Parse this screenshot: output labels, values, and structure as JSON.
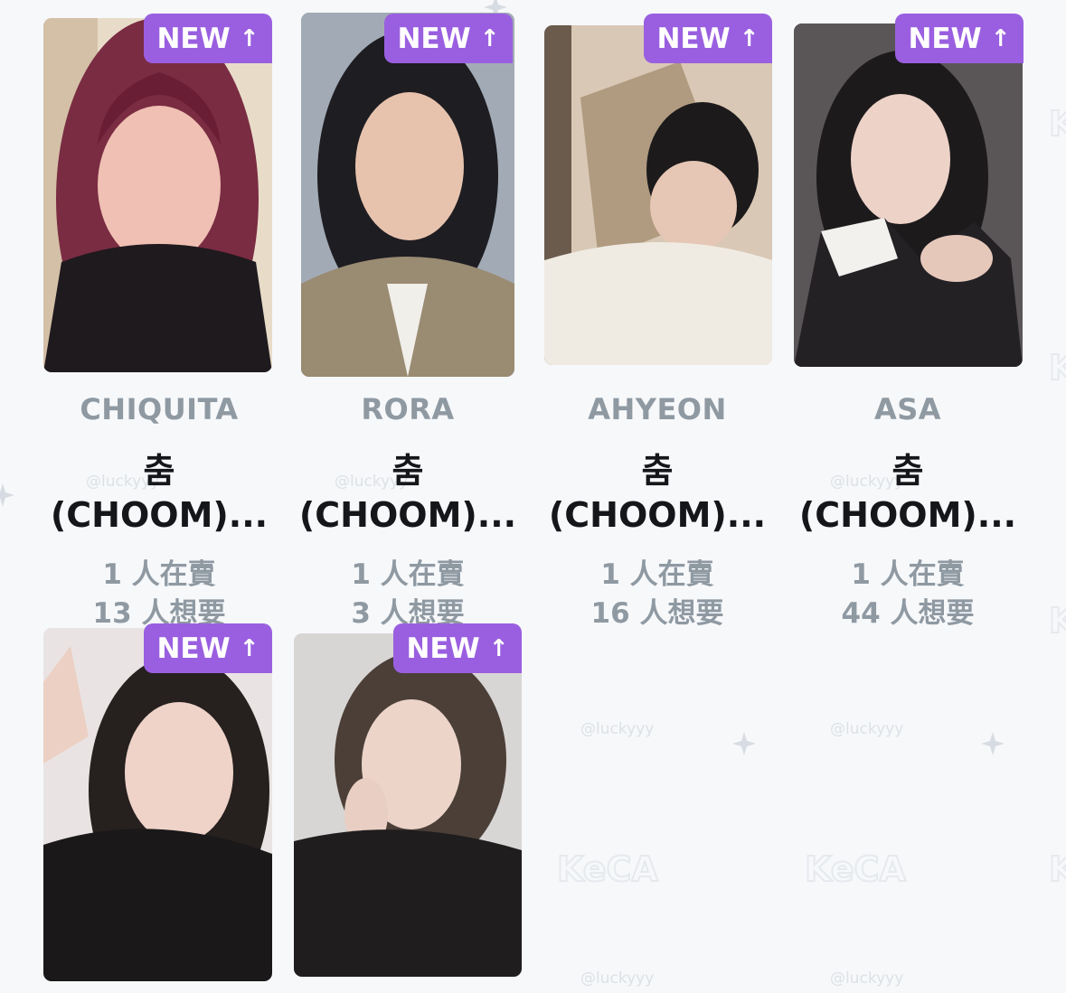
{
  "badge_label": "NEW",
  "watermark": {
    "logo": "KeCA",
    "handle": "@luckyyy"
  },
  "colors": {
    "background": "#f6f8fa",
    "badge": "#9a5fe0",
    "name": "#8f99a2",
    "title": "#14161a"
  },
  "cards": [
    {
      "name": "CHIQUITA",
      "title_line1": "춤",
      "title_line2": "(CHOOM)...",
      "sellers": "1 人在賣",
      "wanters": "13 人想要"
    },
    {
      "name": "RORA",
      "title_line1": "춤",
      "title_line2": "(CHOOM)...",
      "sellers": "1 人在賣",
      "wanters": "3 人想要"
    },
    {
      "name": "AHYEON",
      "title_line1": "춤",
      "title_line2": "(CHOOM)...",
      "sellers": "1 人在賣",
      "wanters": "16 人想要"
    },
    {
      "name": "ASA",
      "title_line1": "춤",
      "title_line2": "(CHOOM)...",
      "sellers": "1 人在賣",
      "wanters": "44 人想要"
    },
    {
      "name": "",
      "title_line1": "",
      "title_line2": "",
      "sellers": "",
      "wanters": ""
    },
    {
      "name": "",
      "title_line1": "",
      "title_line2": "",
      "sellers": "",
      "wanters": ""
    }
  ]
}
